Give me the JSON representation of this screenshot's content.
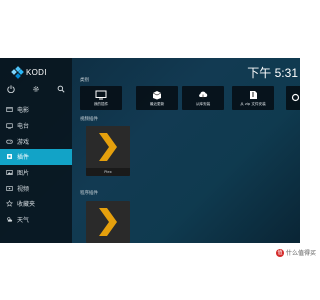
{
  "app": {
    "name": "KODI",
    "brand_color": "#12a3c7"
  },
  "clock": "下午 5:31",
  "quick_actions": [
    {
      "icon": "power-icon"
    },
    {
      "icon": "gear-icon"
    },
    {
      "icon": "search-icon"
    }
  ],
  "sidebar": {
    "items": [
      {
        "label": "电影",
        "icon": "movie-icon",
        "active": false
      },
      {
        "label": "电台",
        "icon": "tv-icon",
        "active": false
      },
      {
        "label": "游戏",
        "icon": "gamepad-icon",
        "active": false
      },
      {
        "label": "插件",
        "icon": "addons-icon",
        "active": true
      },
      {
        "label": "图片",
        "icon": "picture-icon",
        "active": false
      },
      {
        "label": "视频",
        "icon": "video-icon",
        "active": false
      },
      {
        "label": "收藏夹",
        "icon": "star-icon",
        "active": false
      },
      {
        "label": "天气",
        "icon": "weather-icon",
        "active": false
      }
    ]
  },
  "main": {
    "categories_title": "类别",
    "category_tiles": [
      {
        "label": "我的插件",
        "icon": "monitor-icon"
      },
      {
        "label": "最近更新",
        "icon": "box-icon"
      },
      {
        "label": "从库安装",
        "icon": "cloud-download-icon"
      },
      {
        "label": "从 zip 文件安装",
        "icon": "zip-icon"
      }
    ],
    "video_addons_title": "视频插件",
    "program_addons_title": "程序插件",
    "video_addons": [
      {
        "name": "Plex",
        "icon": "plex-icon"
      }
    ],
    "program_addons": [
      {
        "name": "",
        "icon": "plex-icon"
      }
    ]
  },
  "watermark": {
    "badge": "值",
    "text": "什么值得买"
  }
}
